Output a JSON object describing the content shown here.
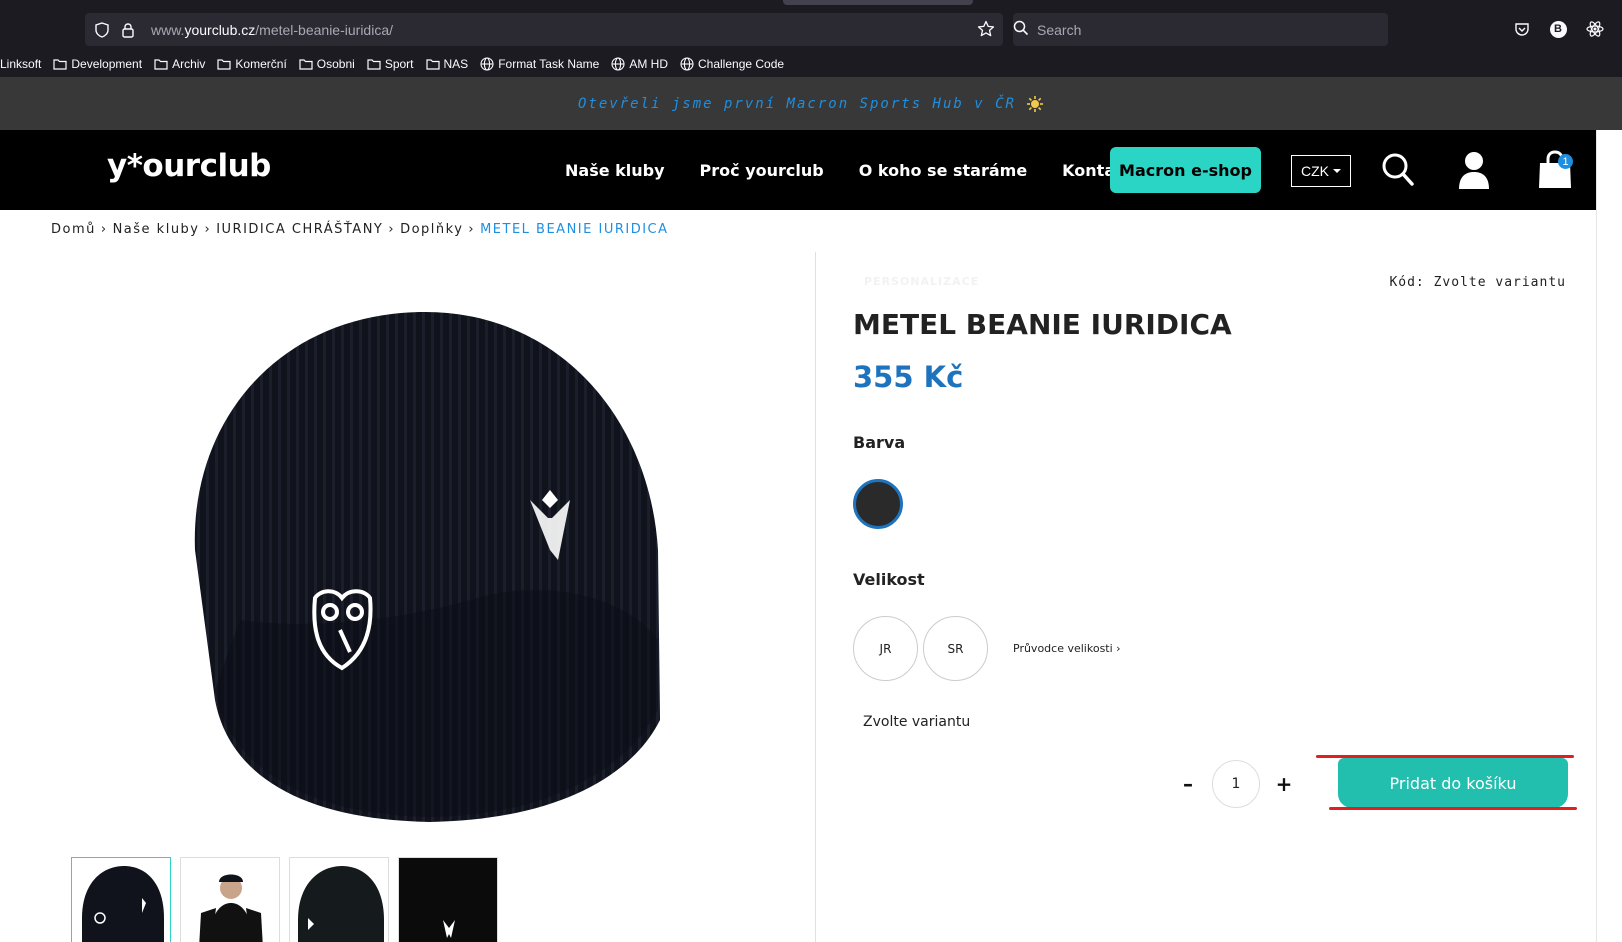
{
  "browser": {
    "url_prefix": "www.",
    "url_host": "yourclub.cz",
    "url_path": "/metel-beanie-iuridica/",
    "search_placeholder": "Search",
    "account_initial": "B",
    "bookmarks": [
      {
        "label": "Linksoft",
        "icon": "none"
      },
      {
        "label": "Development",
        "icon": "folder-icon"
      },
      {
        "label": "Archiv",
        "icon": "folder-icon"
      },
      {
        "label": "Komerční",
        "icon": "folder-icon"
      },
      {
        "label": "Osobni",
        "icon": "folder-icon"
      },
      {
        "label": "Sport",
        "icon": "folder-icon"
      },
      {
        "label": "NAS",
        "icon": "folder-icon"
      },
      {
        "label": "Format Task Name",
        "icon": "globe-icon"
      },
      {
        "label": "AM HD",
        "icon": "globe-icon"
      },
      {
        "label": "Challenge Code",
        "icon": "globe-icon"
      }
    ]
  },
  "announcement": {
    "text": "Otevřeli jsme první Macron Sports Hub v ČR",
    "icon": "sparkle-icon"
  },
  "header": {
    "logo": "y*ourclub",
    "nav": [
      "Naše kluby",
      "Proč yourclub",
      "O koho se staráme",
      "Kontakt"
    ],
    "eshop_label": "Macron e-shop",
    "currency": "CZK",
    "cart_count": "1"
  },
  "breadcrumb": {
    "items": [
      "Domů",
      "Naše kluby",
      "IURIDICA CHRÁŠŤANY",
      "Doplňky"
    ],
    "current": "METEL BEANIE IURIDICA",
    "separator": "›"
  },
  "product": {
    "personalization_label": "PERSONALIZACE",
    "code_label": "Kód: Zvolte variantu",
    "title": "METEL BEANIE IURIDICA",
    "price": "355 Kč",
    "color_label": "Barva",
    "color_value": "#2a2a2a",
    "size_label": "Velikost",
    "sizes": [
      "JR",
      "SR"
    ],
    "size_guide": "Průvodce velikosti ›",
    "variant_message": "Zvolte variantu",
    "quantity": "1",
    "minus": "–",
    "plus": "+",
    "add_to_cart": "Pridat do košíku"
  },
  "colors": {
    "accent_teal": "#2ad5c6",
    "price_blue": "#1e73be",
    "annotation_red": "#e01f1f"
  }
}
